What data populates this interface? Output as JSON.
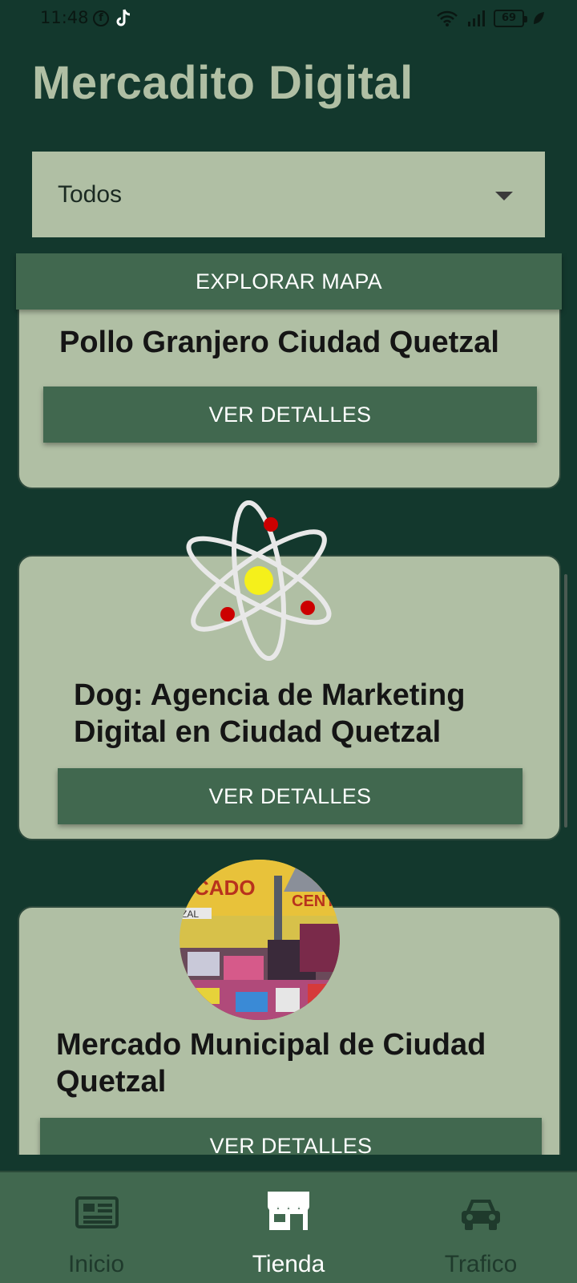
{
  "status_bar": {
    "time": "11:48",
    "battery": "69"
  },
  "app": {
    "title": "Mercadito Digital"
  },
  "filter": {
    "selected": "Todos"
  },
  "explore_button": "EXPLORAR MAPA",
  "cards": [
    {
      "title": "Pollo Granjero Ciudad Quetzal",
      "button": "VER DETALLES"
    },
    {
      "title": "Dog: Agencia de Marketing Digital en Ciudad Quetzal",
      "button": "VER DETALLES"
    },
    {
      "title": "Mercado Municipal de Ciudad Quetzal",
      "button": "VER DETALLES",
      "image_text": [
        "CADO",
        "CENT",
        "ZAL"
      ]
    }
  ],
  "bottom_nav": {
    "items": [
      {
        "label": "Inicio",
        "icon": "newspaper-icon"
      },
      {
        "label": "Tienda",
        "icon": "store-icon"
      },
      {
        "label": "Trafico",
        "icon": "car-icon"
      }
    ],
    "active_color": "#ffffff",
    "inactive_color": "#1f3a2c"
  },
  "colors": {
    "background": "#13382d",
    "card": "#b0bfa4",
    "button": "#41684f",
    "title": "#b0bfa4"
  }
}
